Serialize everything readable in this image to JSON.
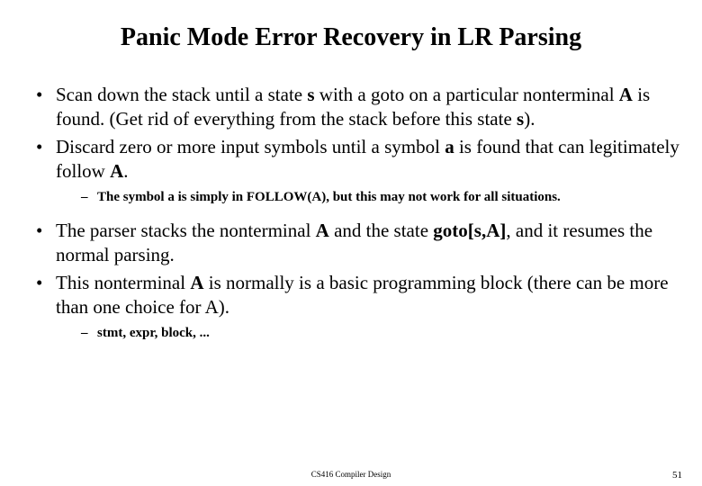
{
  "title": "Panic Mode Error Recovery in LR Parsing",
  "bullets": {
    "b1a": "Scan down the stack until a state ",
    "b1s": "s",
    "b1b": " with a goto on a particular nonterminal ",
    "b1A": "A",
    "b1c": " is found. (Get rid of everything from the stack before this state ",
    "b1s2": "s",
    "b1d": ").",
    "b2a": "Discard zero or more input symbols until a symbol ",
    "b2sym": "a",
    "b2b": " is found that can legitimately follow ",
    "b2A": "A",
    "b2c": ".",
    "b2sub": "The symbol a is simply in FOLLOW(A), but this may not work for all situations.",
    "b3a": "The parser stacks the nonterminal ",
    "b3A": "A",
    "b3b": " and  the state ",
    "b3goto": "goto[s,A]",
    "b3c": ", and it resumes the normal parsing.",
    "b4a": "This nonterminal ",
    "b4A": "A",
    "b4b": " is normally is a basic programming block (there can be more than one choice for A).",
    "b4sub": "stmt, expr, block, ..."
  },
  "footer": {
    "course": "CS416 Compiler Design",
    "page": "51"
  }
}
